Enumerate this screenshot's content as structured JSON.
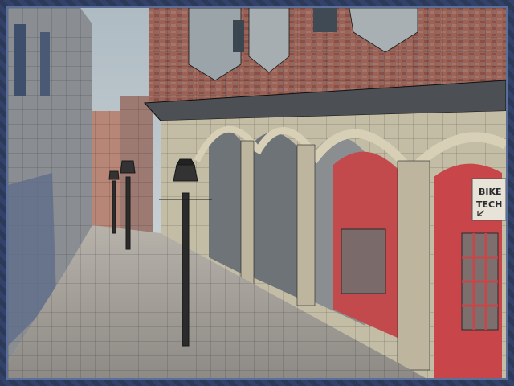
{
  "scene": {
    "sign": {
      "line1": "BIKE",
      "line2": "TECH"
    },
    "colors": {
      "sky": "#b9c6cc",
      "brick_upper": "#9a6a5e",
      "stone_arch": "#c8c0a8",
      "red_door": "#c8464a",
      "paving": "#a09c96",
      "wireframe": "#1a1a1a",
      "frame_border": "#2f3c5a"
    },
    "icons": [
      "lamp-post-icon",
      "sign-arrow-icon"
    ]
  }
}
